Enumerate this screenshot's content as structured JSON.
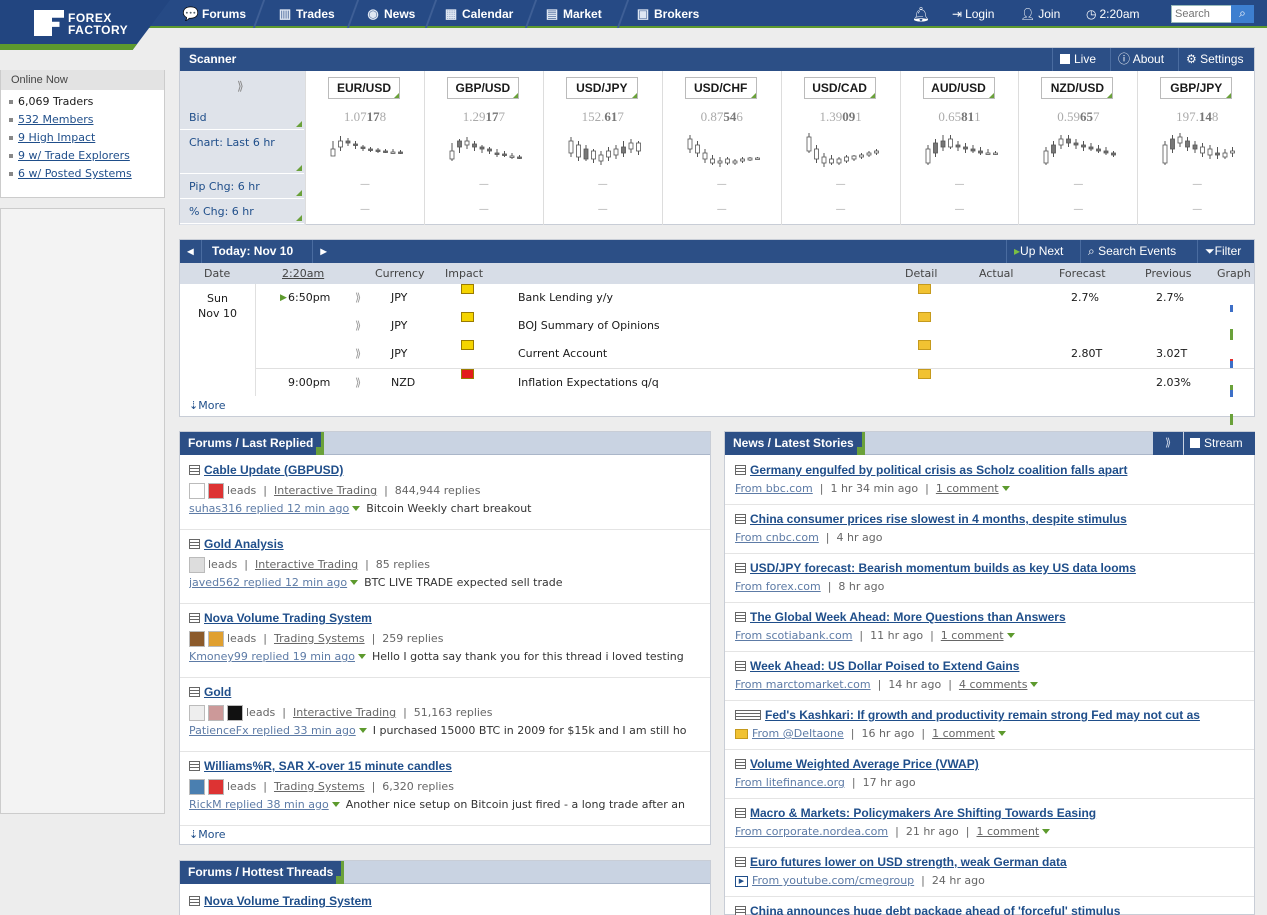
{
  "nav": {
    "logo_line1": "FOREX",
    "logo_line2": "FACTORY",
    "items": [
      {
        "label": "Forums",
        "icon": "forums-icon"
      },
      {
        "label": "Trades",
        "icon": "trades-icon"
      },
      {
        "label": "News",
        "icon": "news-icon"
      },
      {
        "label": "Calendar",
        "icon": "calendar-icon"
      },
      {
        "label": "Market",
        "icon": "market-icon"
      },
      {
        "label": "Brokers",
        "icon": "brokers-icon"
      }
    ],
    "login": "Login",
    "join": "Join",
    "time": "2:20am",
    "search_placeholder": "Search"
  },
  "online": {
    "title": "Online Now",
    "traders": "6,069 Traders",
    "members": "532 Members",
    "high_impact": "9 High Impact",
    "trade_explorers": "9 w/ Trade Explorers",
    "posted_systems": "6 w/ Posted Systems"
  },
  "scanner": {
    "title": "Scanner",
    "live": "Live",
    "about": "About",
    "settings": "Settings",
    "rows": {
      "bid": "Bid",
      "chart": "Chart: Last 6 hr",
      "pip": "Pip Chg: 6 hr",
      "pct": "% Chg: 6 hr"
    },
    "dash": "—",
    "pairs": [
      {
        "name": "EUR/USD",
        "bid_dim": "1.07",
        "bid_bold": "17",
        "bid_end": "8"
      },
      {
        "name": "GBP/USD",
        "bid_dim": "1.29",
        "bid_bold": "17",
        "bid_end": "7"
      },
      {
        "name": "USD/JPY",
        "bid_dim": "152.",
        "bid_bold": "61",
        "bid_end": "7"
      },
      {
        "name": "USD/CHF",
        "bid_dim": "0.87",
        "bid_bold": "54",
        "bid_end": "6"
      },
      {
        "name": "USD/CAD",
        "bid_dim": "1.39",
        "bid_bold": "09",
        "bid_end": "1"
      },
      {
        "name": "AUD/USD",
        "bid_dim": "0.65",
        "bid_bold": "81",
        "bid_end": "1"
      },
      {
        "name": "NZD/USD",
        "bid_dim": "0.59",
        "bid_bold": "65",
        "bid_end": "7"
      },
      {
        "name": "GBP/JPY",
        "bid_dim": "197.",
        "bid_bold": "14",
        "bid_end": "8"
      }
    ]
  },
  "calendar": {
    "title": "Today: Nov 10",
    "up_next": "Up Next",
    "search_events": "Search Events",
    "filter": "Filter",
    "headers": {
      "date": "Date",
      "time": "2:20am",
      "currency": "Currency",
      "impact": "Impact",
      "detail": "Detail",
      "actual": "Actual",
      "forecast": "Forecast",
      "previous": "Previous",
      "graph": "Graph"
    },
    "day": "Sun",
    "date": "Nov 10",
    "events": [
      {
        "time": "6:50pm",
        "currency": "JPY",
        "impact": "yellow",
        "event": "Bank Lending y/y",
        "actual": "",
        "forecast": "2.7%",
        "previous": "2.7%",
        "graph": true
      },
      {
        "time": "",
        "currency": "JPY",
        "impact": "yellow",
        "event": "BOJ Summary of Opinions",
        "actual": "",
        "forecast": "",
        "previous": "",
        "graph": false
      },
      {
        "time": "",
        "currency": "JPY",
        "impact": "yellow",
        "event": "Current Account",
        "actual": "",
        "forecast": "2.80T",
        "previous": "3.02T",
        "graph": true
      },
      {
        "time": "9:00pm",
        "currency": "NZD",
        "impact": "red",
        "event": "Inflation Expectations q/q",
        "actual": "",
        "forecast": "",
        "previous": "2.03%",
        "graph": true
      }
    ],
    "more": "More"
  },
  "forums": {
    "title": "Forums / Last Replied",
    "threads": [
      {
        "title": "Cable Update (GBPUSD)",
        "leads": "leads",
        "forum": "Interactive Trading",
        "replies": "844,944 replies",
        "who": "suhas316 replied 12 min ago",
        "excerpt": "Bitcoin Weekly chart breakout"
      },
      {
        "title": "Gold Analysis",
        "leads": "leads",
        "forum": "Interactive Trading",
        "replies": "85 replies",
        "who": "javed562 replied 12 min ago",
        "excerpt": "BTC LIVE TRADE expected sell trade"
      },
      {
        "title": "Nova Volume Trading System",
        "leads": "leads",
        "forum": "Trading Systems",
        "replies": "259 replies",
        "who": "Kmoney99 replied 19 min ago",
        "excerpt": "Hello I gotta say thank you for this thread i loved testing"
      },
      {
        "title": "Gold",
        "leads": "leads",
        "forum": "Interactive Trading",
        "replies": "51,163 replies",
        "who": "PatienceFx replied 33 min ago",
        "excerpt": "I purchased 15000 BTC in 2009 for $15k and I am still ho"
      },
      {
        "title": "Williams%R, SAR X-over 15 minute candles",
        "leads": "leads",
        "forum": "Trading Systems",
        "replies": "6,320 replies",
        "who": "RickM replied 38 min ago",
        "excerpt": "Another nice setup on Bitcoin just fired - a long trade after an"
      }
    ],
    "more": "More"
  },
  "hot": {
    "title": "Forums / Hottest Threads",
    "first": "Nova Volume Trading System"
  },
  "news": {
    "title": "News / Latest Stories",
    "stream": "Stream",
    "stories": [
      {
        "title": "Germany engulfed by political crisis as Scholz coalition falls apart",
        "source": "From bbc.com",
        "age": "1 hr 34 min ago",
        "comments": "1 comment"
      },
      {
        "title": "China consumer prices rise slowest in 4 months, despite stimulus",
        "source": "From cnbc.com",
        "age": "4 hr ago",
        "comments": ""
      },
      {
        "title": "USD/JPY forecast: Bearish momentum builds as key US data looms",
        "source": "From forex.com",
        "age": "8 hr ago",
        "comments": ""
      },
      {
        "title": "The Global Week Ahead: More Questions than Answers",
        "source": "From scotiabank.com",
        "age": "11 hr ago",
        "comments": "1 comment"
      },
      {
        "title": "Week Ahead: US Dollar Poised to Extend Gains",
        "source": "From marctomarket.com",
        "age": "14 hr ago",
        "comments": "4 comments"
      },
      {
        "title": "Fed's Kashkari: If growth and productivity remain strong Fed may not cut as",
        "source": "From @DeItaone",
        "age": "16 hr ago",
        "comments": "1 comment"
      },
      {
        "title": "Volume Weighted Average Price (VWAP)",
        "source": "From litefinance.org",
        "age": "17 hr ago",
        "comments": ""
      },
      {
        "title": "Macro & Markets: Policymakers Are Shifting Towards Easing",
        "source": "From corporate.nordea.com",
        "age": "21 hr ago",
        "comments": "1 comment"
      },
      {
        "title": "Euro futures lower on USD strength, weak German data",
        "source": "From youtube.com/cmegroup",
        "age": "24 hr ago",
        "comments": ""
      },
      {
        "title": "China announces huge debt package ahead of 'forceful' stimulus",
        "source": "",
        "age": "",
        "comments": ""
      }
    ]
  }
}
